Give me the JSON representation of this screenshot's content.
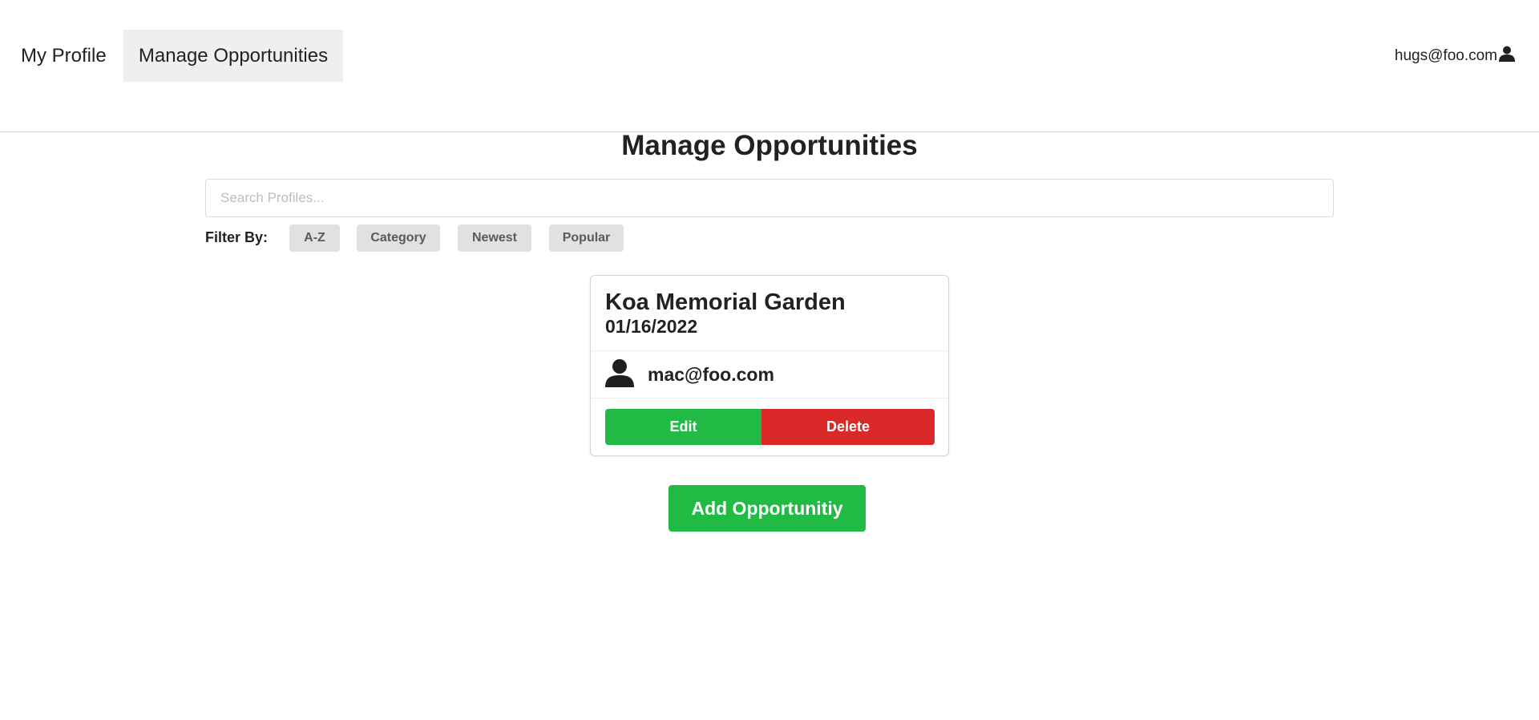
{
  "nav": {
    "items": [
      {
        "label": "My Profile",
        "active": false
      },
      {
        "label": "Manage Opportunities",
        "active": true
      }
    ],
    "user": {
      "email": "hugs@foo.com",
      "icon": "user-icon"
    }
  },
  "page": {
    "title": "Manage Opportunities"
  },
  "search": {
    "placeholder": "Search Profiles...",
    "value": ""
  },
  "filter": {
    "label": "Filter By:",
    "options": [
      "A-Z",
      "Category",
      "Newest",
      "Popular"
    ]
  },
  "opportunities": [
    {
      "title": "Koa Memorial Garden",
      "date": "01/16/2022",
      "owner": "mac@foo.com",
      "owner_icon": "user-icon",
      "edit_label": "Edit",
      "delete_label": "Delete"
    }
  ],
  "actions": {
    "add_label": "Add Opportunitiy"
  },
  "colors": {
    "green": "#21ba45",
    "red": "#db2828",
    "filter_bg": "#e0e1e2",
    "active_nav_bg": "#efefef"
  }
}
